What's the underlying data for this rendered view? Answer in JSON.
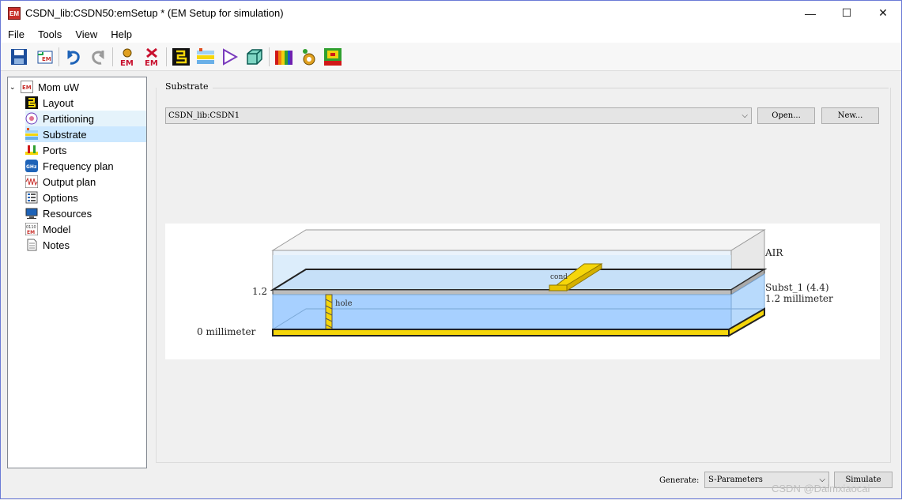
{
  "window": {
    "app_icon_text": "EM",
    "title": "CSDN_lib:CSDN50:emSetup * (EM Setup for simulation)",
    "controls": {
      "minimize": "—",
      "maximize": "☐",
      "close": "✕"
    }
  },
  "menu": [
    "File",
    "Tools",
    "View",
    "Help"
  ],
  "toolbar": {
    "icons": [
      "save-icon",
      "export-em-icon",
      "undo-icon",
      "redo-icon",
      "em-settings-icon",
      "em-remove-icon",
      "layout-icon",
      "substrate-icon",
      "triangle-icon",
      "cube-icon",
      "spectrum-icon",
      "gear-person-icon",
      "heatmap-icon"
    ]
  },
  "tree": {
    "root": {
      "label": "Mom uW",
      "expanded": true
    },
    "items": [
      {
        "label": "Layout",
        "icon": "layout-icon",
        "state": "normal"
      },
      {
        "label": "Partitioning",
        "icon": "partitioning-icon",
        "state": "hover"
      },
      {
        "label": "Substrate",
        "icon": "substrate-icon",
        "state": "selected"
      },
      {
        "label": "Ports",
        "icon": "ports-icon",
        "state": "normal"
      },
      {
        "label": "Frequency plan",
        "icon": "ghz-icon",
        "state": "normal"
      },
      {
        "label": "Output plan",
        "icon": "waveform-icon",
        "state": "normal"
      },
      {
        "label": "Options",
        "icon": "options-icon",
        "state": "normal"
      },
      {
        "label": "Resources",
        "icon": "monitor-icon",
        "state": "normal"
      },
      {
        "label": "Model",
        "icon": "model-icon",
        "state": "normal"
      },
      {
        "label": "Notes",
        "icon": "notes-icon",
        "state": "normal"
      }
    ]
  },
  "substrate": {
    "group_label": "Substrate",
    "selected": "CSDN_lib:CSDN1",
    "open_button": "Open...",
    "new_button": "New..."
  },
  "diagram": {
    "left_labels": {
      "top_height": "1.2",
      "bottom_height": "0 millimeter"
    },
    "right_labels": {
      "air": "AIR",
      "subst_name": "Subst_1 (4.4)",
      "subst_thickness": "1.2 millimeter"
    },
    "conductor_label": "cond",
    "via_label": "hole",
    "colors": {
      "air": "#ffffff",
      "dielectric": "#a7d0ff",
      "metal": "#f5d60a",
      "metal_edge": "#222222"
    }
  },
  "footer": {
    "generate_label": "Generate:",
    "generate_value": "S-Parameters",
    "simulate_button": "Simulate",
    "watermark": "CSDN @Daimxiaocai"
  }
}
